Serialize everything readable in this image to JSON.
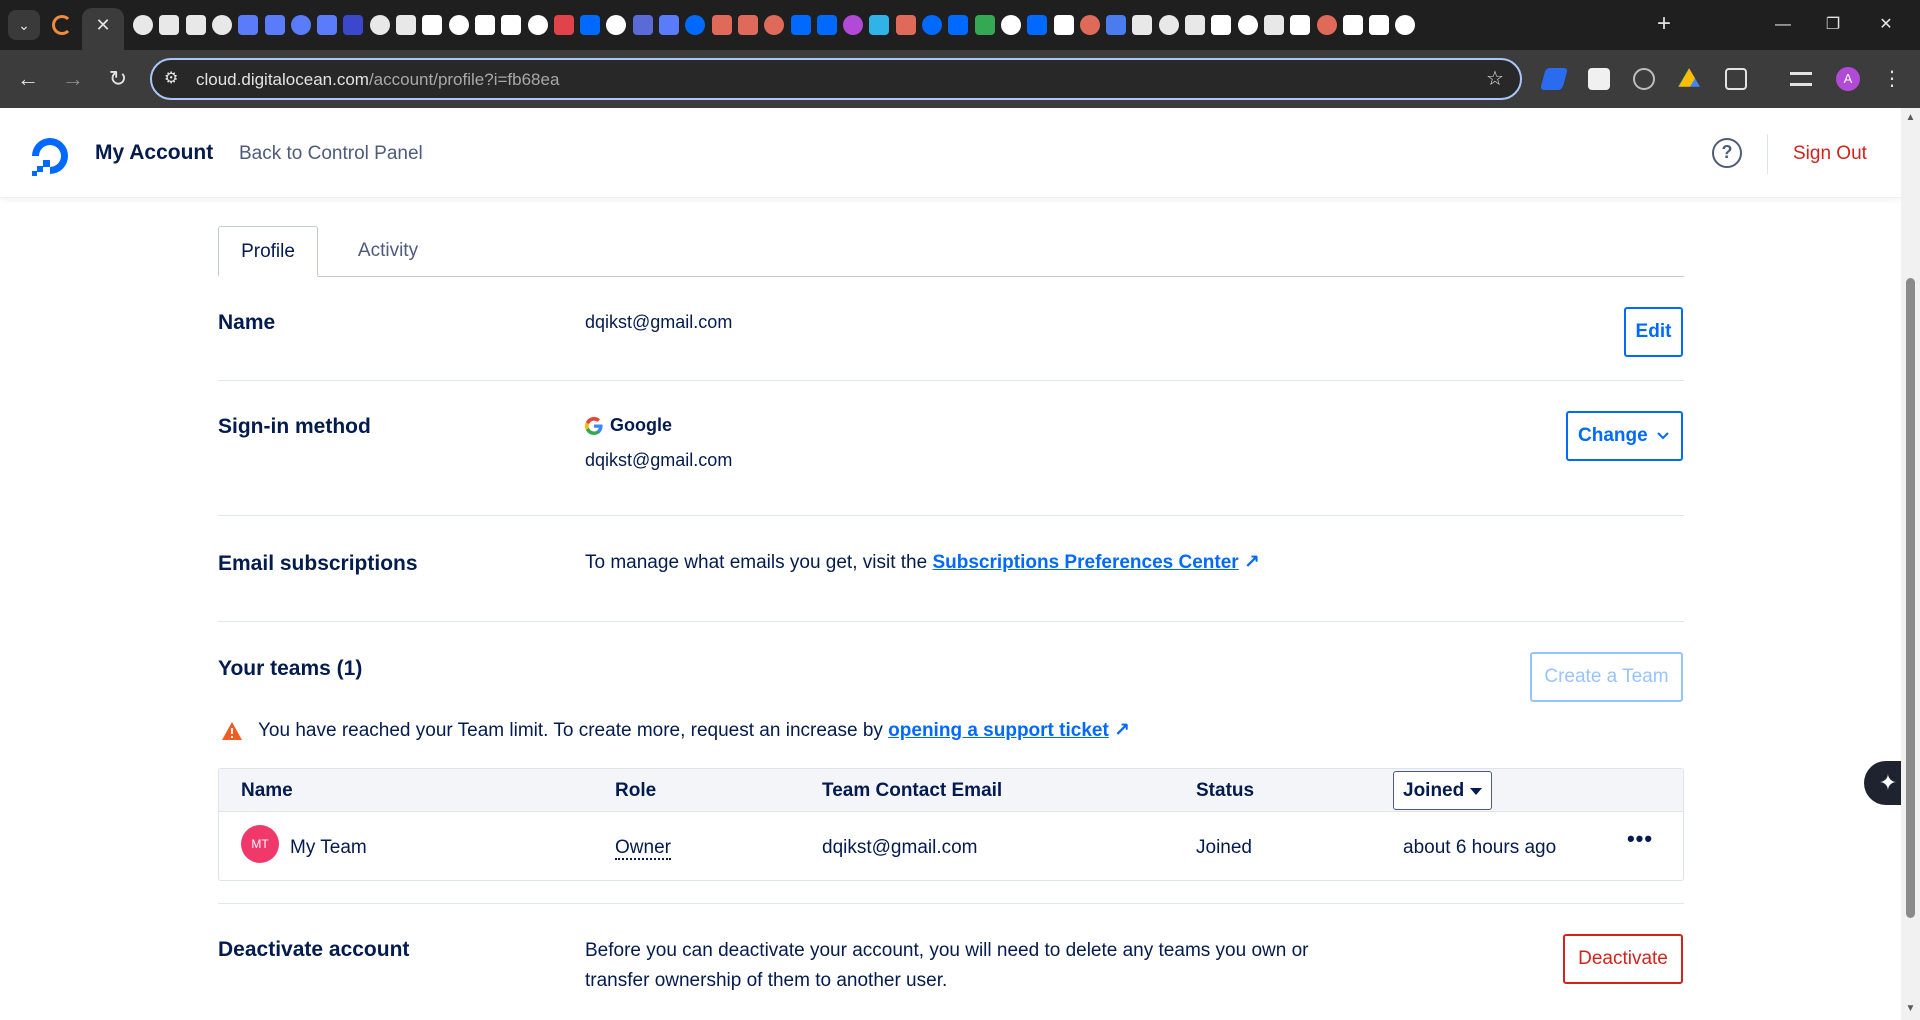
{
  "browser": {
    "tab_menu": "⌄",
    "active_tab_close": "✕",
    "new_tab": "+",
    "window_controls": {
      "minimize": "—",
      "restore": "❐",
      "close": "✕"
    },
    "url_host": "cloud.digitalocean.com",
    "url_path": "/account/profile?i=fb68ea",
    "profile_initial": "A",
    "favicon_colors": [
      "#e8e8e8",
      "#e8e8e8",
      "#e8e8e8",
      "#e8e8e8",
      "#5b7cfa",
      "#5b7cfa",
      "#5b7cfa",
      "#5b7cfa",
      "#3b48cc",
      "#e8e8e8",
      "#e8e8e8",
      "#ffffff",
      "#ffffff",
      "#ffffff",
      "#ffffff",
      "#ffffff",
      "#e0444a",
      "#0069ff",
      "#ffffff",
      "#5a6bd8",
      "#5b7cfa",
      "#0069ff",
      "#e06a5a",
      "#e06a5a",
      "#e06a5a",
      "#0069ff",
      "#0069ff",
      "#b14ad7",
      "#2fb3e8",
      "#e06a5a",
      "#0069ff",
      "#0069ff",
      "#34a853",
      "#ffffff",
      "#0069ff",
      "#ffffff",
      "#e06a5a",
      "#4a7cf0",
      "#e8e8e8",
      "#e8e8e8",
      "#e8e8e8",
      "#ffffff",
      "#ffffff",
      "#e8e8e8",
      "#ffffff",
      "#e06a5a",
      "#ffffff",
      "#ffffff",
      "#ffffff"
    ]
  },
  "header": {
    "title": "My Account",
    "back_link": "Back to Control Panel",
    "help": "?",
    "sign_out": "Sign Out"
  },
  "tabs": [
    {
      "label": "Profile",
      "active": true
    },
    {
      "label": "Activity",
      "active": false
    }
  ],
  "name_section": {
    "label": "Name",
    "value": "dqikst@gmail.com",
    "edit_button": "Edit"
  },
  "signin_section": {
    "label": "Sign-in method",
    "provider": "Google",
    "email": "dqikst@gmail.com",
    "change_button": "Change"
  },
  "email_subscriptions": {
    "label": "Email subscriptions",
    "text": "To manage what emails you get, visit the ",
    "link": "Subscriptions Preferences Center"
  },
  "teams": {
    "label": "Your teams (1)",
    "create_button": "Create a Team",
    "warning_text": "You have reached your Team limit. To create more, request an increase by ",
    "warning_link": "opening a support ticket",
    "columns": [
      "Name",
      "Role",
      "Team Contact Email",
      "Status"
    ],
    "sort_select": "Joined",
    "rows": [
      {
        "initials": "MT",
        "name": "My Team",
        "role": "Owner",
        "email": "dqikst@gmail.com",
        "status": "Joined",
        "joined": "about 6 hours ago",
        "more": "•••"
      }
    ]
  },
  "deactivate": {
    "label": "Deactivate account",
    "text": "Before you can deactivate your account, you will need to delete any teams you own or transfer ownership of them to another user.",
    "button": "Deactivate"
  },
  "colors": {
    "accent": "#0069ff",
    "danger": "#d3231d",
    "text": "#031b4e",
    "warning": "#f25c20",
    "team_avatar": "#f0386b"
  }
}
